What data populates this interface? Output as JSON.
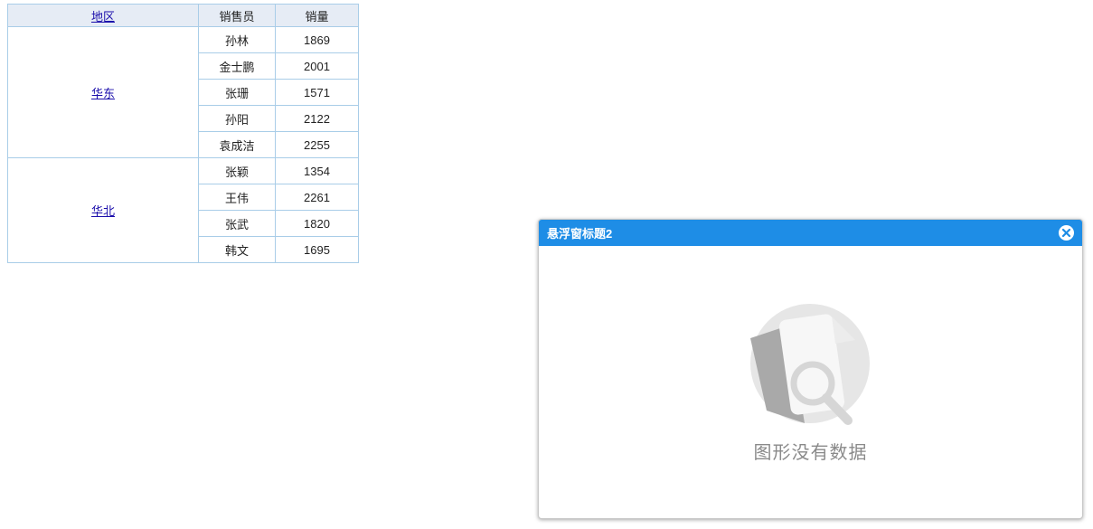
{
  "table": {
    "headers": {
      "region": "地区",
      "salesperson": "销售员",
      "volume": "销量"
    },
    "groups": [
      {
        "region": "华东",
        "rows": [
          {
            "name": "孙林",
            "value": "1869"
          },
          {
            "name": "金士鹏",
            "value": "2001"
          },
          {
            "name": "张珊",
            "value": "1571"
          },
          {
            "name": "孙阳",
            "value": "2122"
          },
          {
            "name": "袁成洁",
            "value": "2255"
          }
        ]
      },
      {
        "region": "华北",
        "rows": [
          {
            "name": "张颖",
            "value": "1354"
          },
          {
            "name": "王伟",
            "value": "2261"
          },
          {
            "name": "张武",
            "value": "1820"
          },
          {
            "name": "韩文",
            "value": "1695"
          }
        ]
      }
    ]
  },
  "popup": {
    "title": "悬浮窗标题2",
    "empty_text": "图形没有数据",
    "close_icon": "close-circle-icon",
    "empty_icon": "no-data-magnifier-icon"
  },
  "colors": {
    "header_bg": "#e6ecf5",
    "border": "#a9cde8",
    "popup_header": "#1e8de6",
    "link": "#1a0dab"
  }
}
